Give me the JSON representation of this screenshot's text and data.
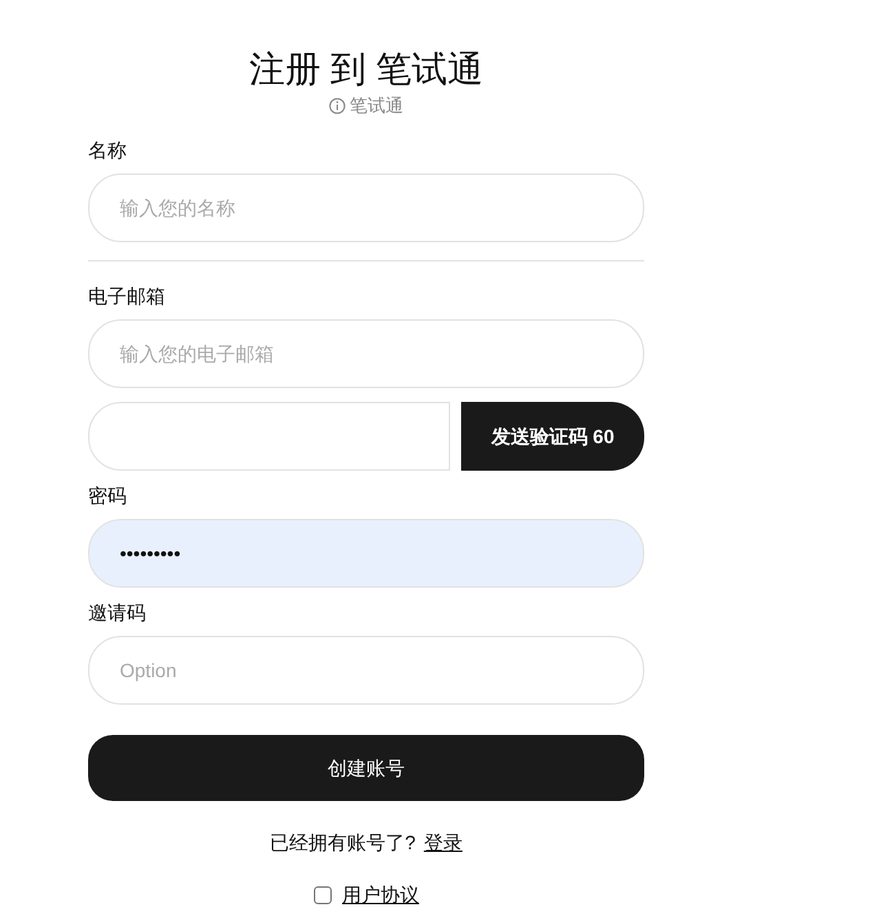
{
  "title": "注册 到 笔试通",
  "subtitle": "笔试通",
  "fields": [
    {
      "label": "名称",
      "placeholder": "输入您的名称",
      "divider_after": true
    },
    {
      "label": "电子邮箱",
      "placeholder": "输入您的电子邮箱",
      "divider_after": false,
      "code_button": "发送验证码 60"
    },
    {
      "label": "密码",
      "value": "•••••••••",
      "autofilled": true,
      "divider_after": false
    },
    {
      "label": "邀请码",
      "placeholder": "Option",
      "divider_after": false
    }
  ],
  "submit": "创建账号",
  "login_prompt": "已经拥有账号了?",
  "login_link": "登录",
  "agreement": {
    "label": "用户协议",
    "checked": false
  }
}
